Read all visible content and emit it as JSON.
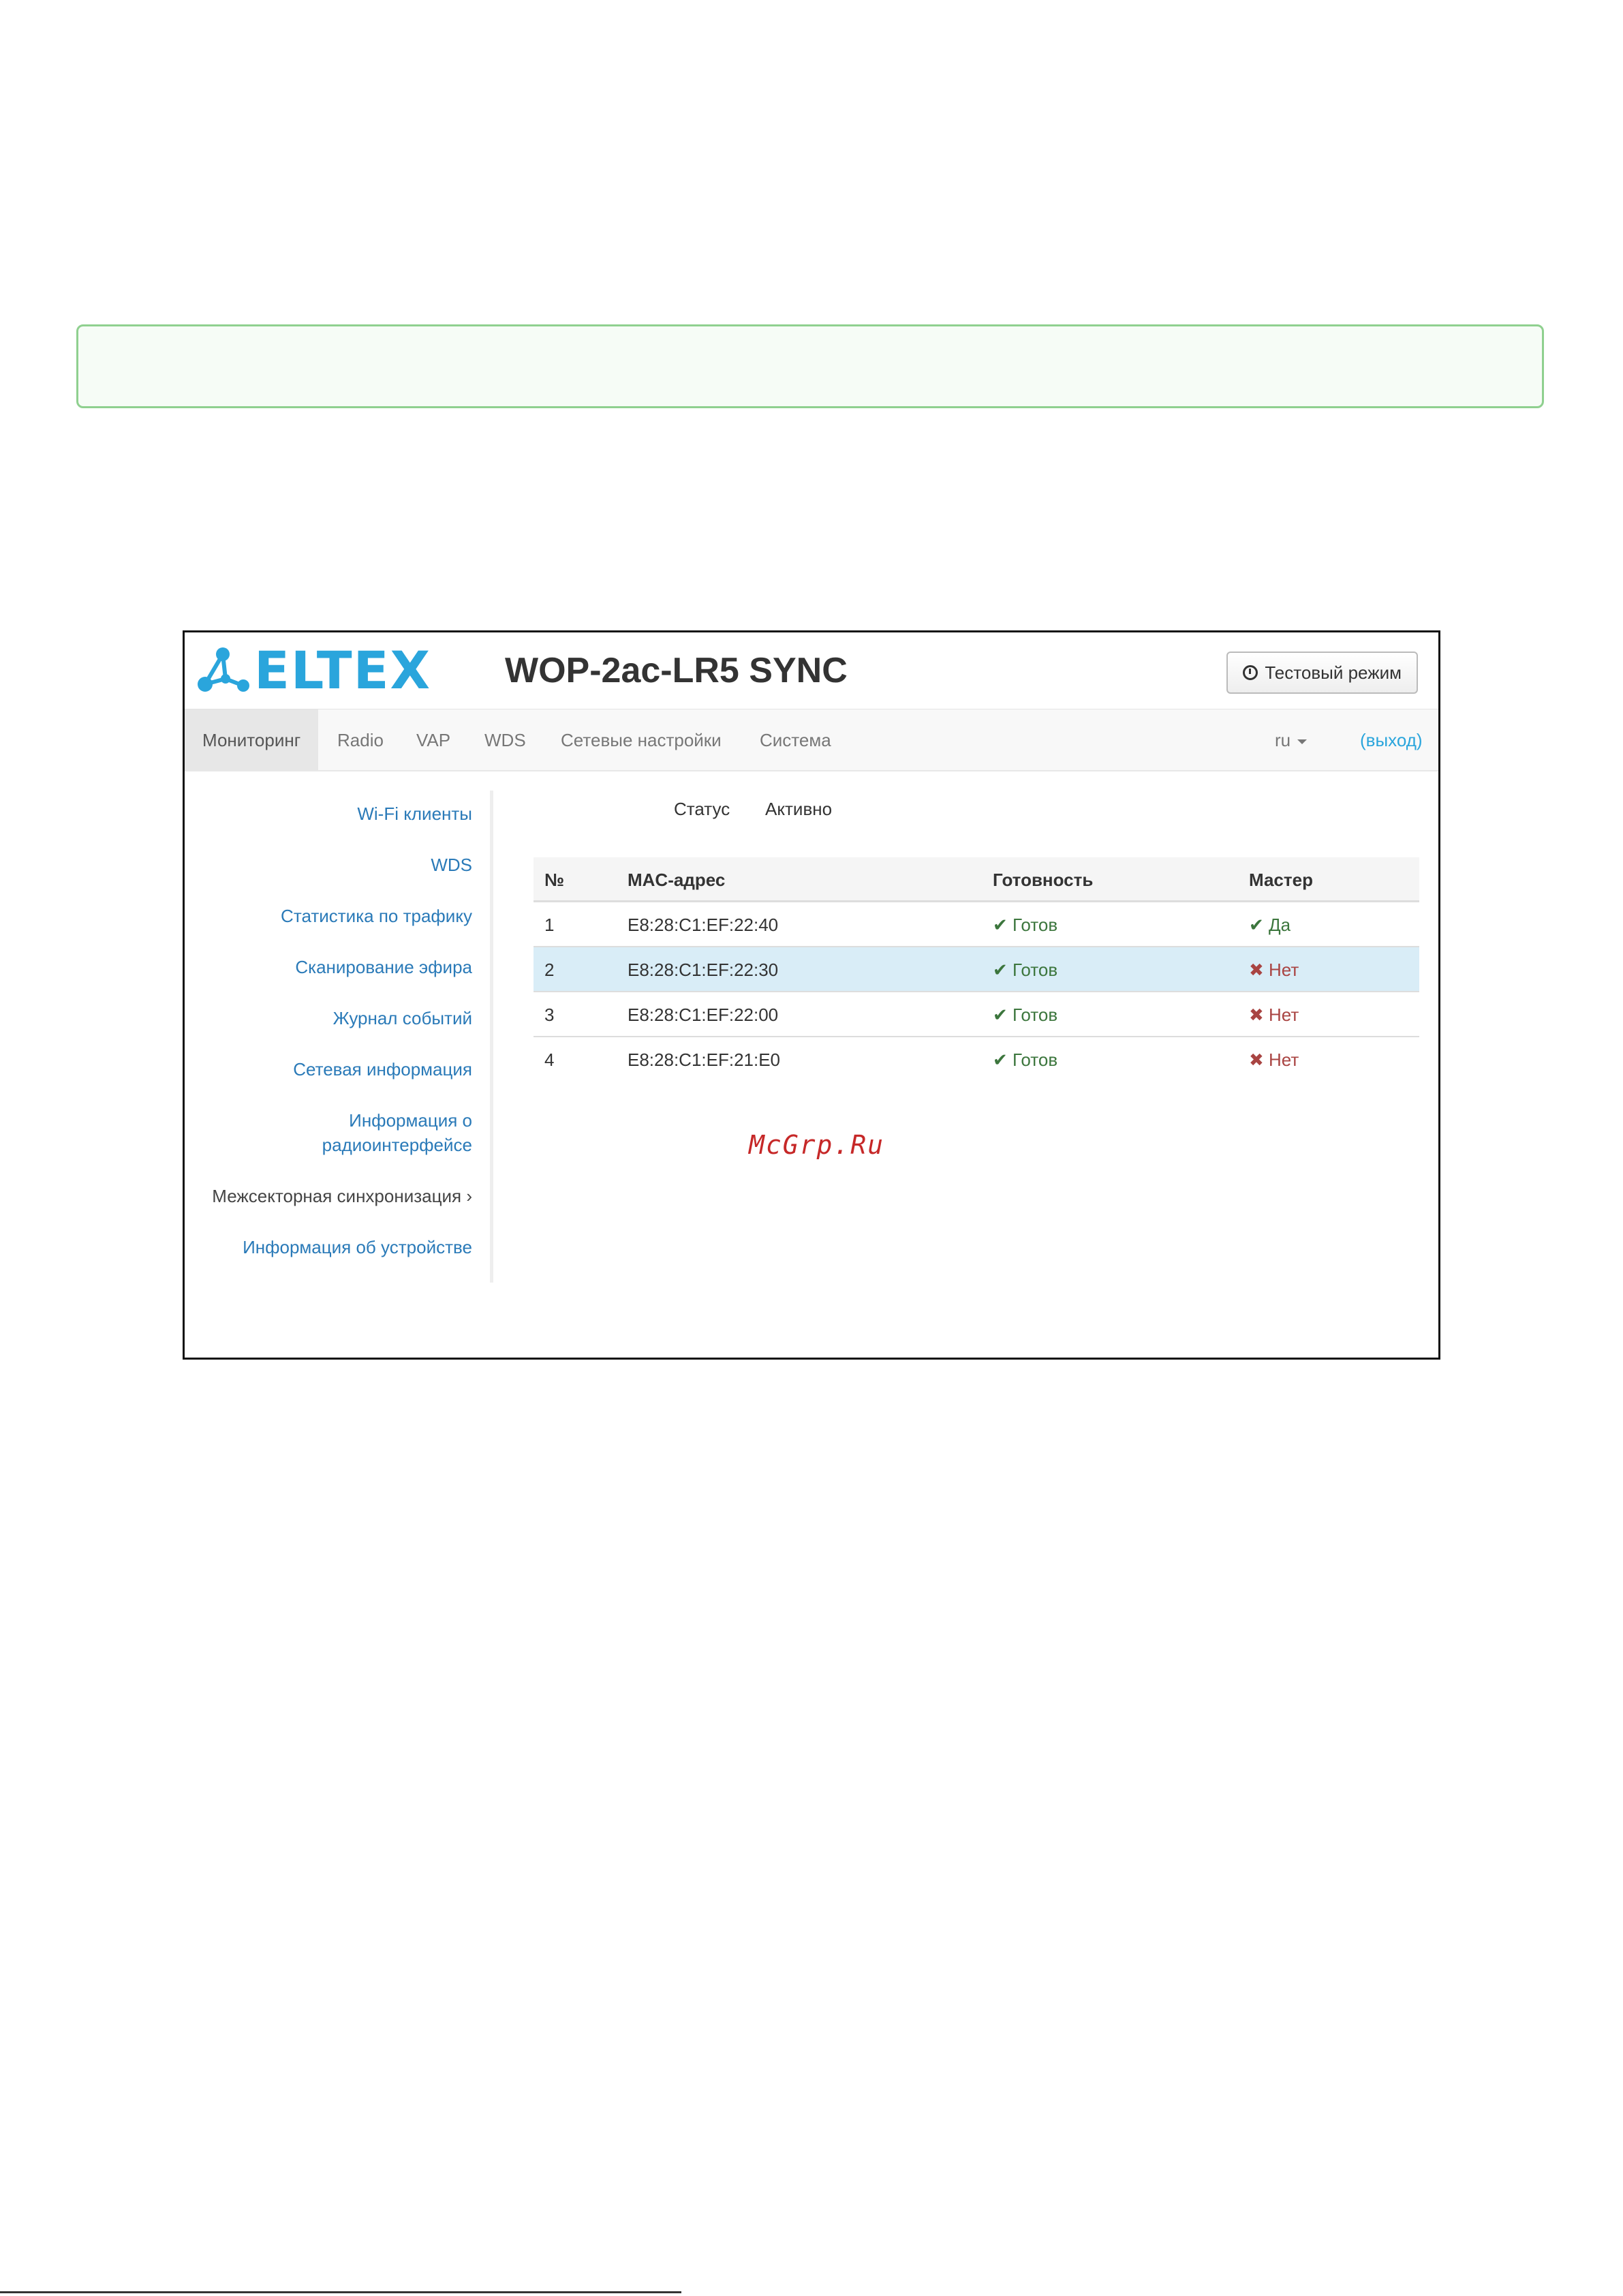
{
  "header": {
    "logo_text": "ELTEX",
    "device_title": "WOP-2ac-LR5 SYNC",
    "test_mode_button": "Тестовый режим"
  },
  "nav": {
    "items": [
      "Мониторинг",
      "Radio",
      "VAP",
      "WDS",
      "Сетевые настройки",
      "Система"
    ],
    "active_index": 0,
    "language": "ru",
    "logout": "(выход)"
  },
  "sidebar": {
    "items": [
      "Wi-Fi клиенты",
      "WDS",
      "Статистика по трафику",
      "Сканирование эфира",
      "Журнал событий",
      "Сетевая информация",
      "Информация о",
      "радиоинтерфейсе",
      "Межсекторная синхронизация ›",
      "Информация об устройстве"
    ]
  },
  "status": {
    "label": "Статус",
    "value": "Активно"
  },
  "table": {
    "headers": [
      "№",
      "MAC-адрес",
      "Готовность",
      "Мастер"
    ],
    "rows": [
      {
        "num": "1",
        "mac": "E8:28:C1:EF:22:40",
        "ready": "Готов",
        "master": "Да",
        "master_ok": true
      },
      {
        "num": "2",
        "mac": "E8:28:C1:EF:22:30",
        "ready": "Готов",
        "master": "Нет",
        "master_ok": false
      },
      {
        "num": "3",
        "mac": "E8:28:C1:EF:22:00",
        "ready": "Готов",
        "master": "Нет",
        "master_ok": false
      },
      {
        "num": "4",
        "mac": "E8:28:C1:EF:21:E0",
        "ready": "Готов",
        "master": "Нет",
        "master_ok": false
      }
    ],
    "highlighted_row": 1
  },
  "watermark": "McGrp.Ru",
  "colors": {
    "brand": "#2aa5dc",
    "ok": "#3c763d",
    "bad": "#a94442",
    "highlight": "#d9edf7"
  }
}
